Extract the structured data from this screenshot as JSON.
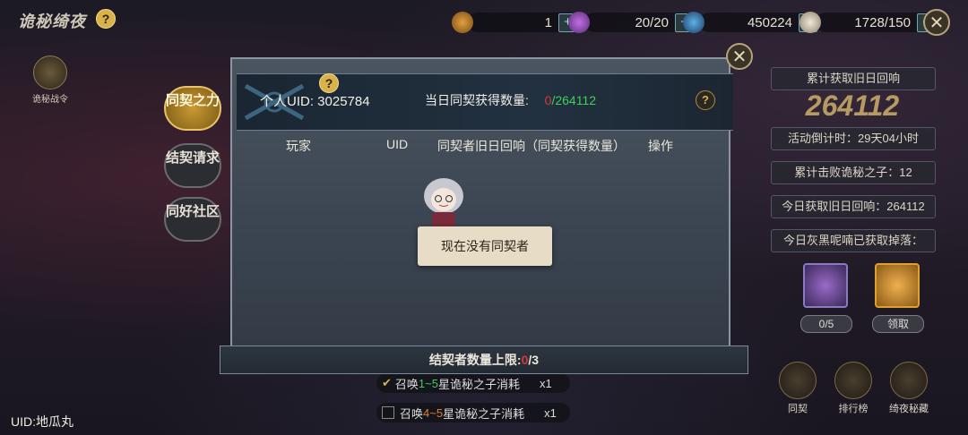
{
  "title": "诡秘绮夜",
  "resources": [
    {
      "icon": "bag-icon",
      "value": "1"
    },
    {
      "icon": "potion-icon",
      "value": "20/20"
    },
    {
      "icon": "sword-icon",
      "value": "450224"
    },
    {
      "icon": "feather-icon",
      "value": "1728/150"
    }
  ],
  "battle_pass_label": "诡秘战令",
  "side_tabs": [
    {
      "label": "同契之力",
      "active": true
    },
    {
      "label": "结契请求",
      "active": false
    },
    {
      "label": "同好社区",
      "active": false
    }
  ],
  "user_uid": "UID:地瓜丸",
  "right_panel": {
    "total_label": "累计获取旧日回响",
    "total_value": "264112",
    "countdown": "活动倒计时：29天04小时",
    "defeated": "累计击败诡秘之子：12",
    "today_echo": "今日获取旧日回响：264112",
    "today_drop": "今日灰黑呢喃已获取掉落：",
    "potion1_count": "0/5",
    "potion2_label": "领取"
  },
  "bottom_buttons": [
    "同契",
    "排行榜",
    "绮夜秘藏"
  ],
  "summons": [
    {
      "prefix": "召唤",
      "range": "1~5",
      "suffix": "星诡秘之子消耗",
      "count": "x1",
      "range_color": "#3fcf5a",
      "checked": true
    },
    {
      "prefix": "召唤",
      "range": "4~5",
      "suffix": "星诡秘之子消耗",
      "count": "x1",
      "range_color": "#e07a2a",
      "checked": false
    }
  ],
  "modal": {
    "personal_uid": "个人UID: 3025784",
    "daily_label": "当日同契获得数量:",
    "daily_current": "0",
    "daily_total": "/264112",
    "columns": [
      "玩家",
      "UID",
      "同契者旧日回响（同契获得数量）",
      "操作"
    ],
    "empty_text": "现在没有同契者",
    "footer_label": "结契者数量上限:",
    "footer_current": "0",
    "footer_total": "/3"
  },
  "colors": {
    "accent_gold": "#d9b24a",
    "green": "#3fcf5a",
    "red": "#d23a3a"
  }
}
